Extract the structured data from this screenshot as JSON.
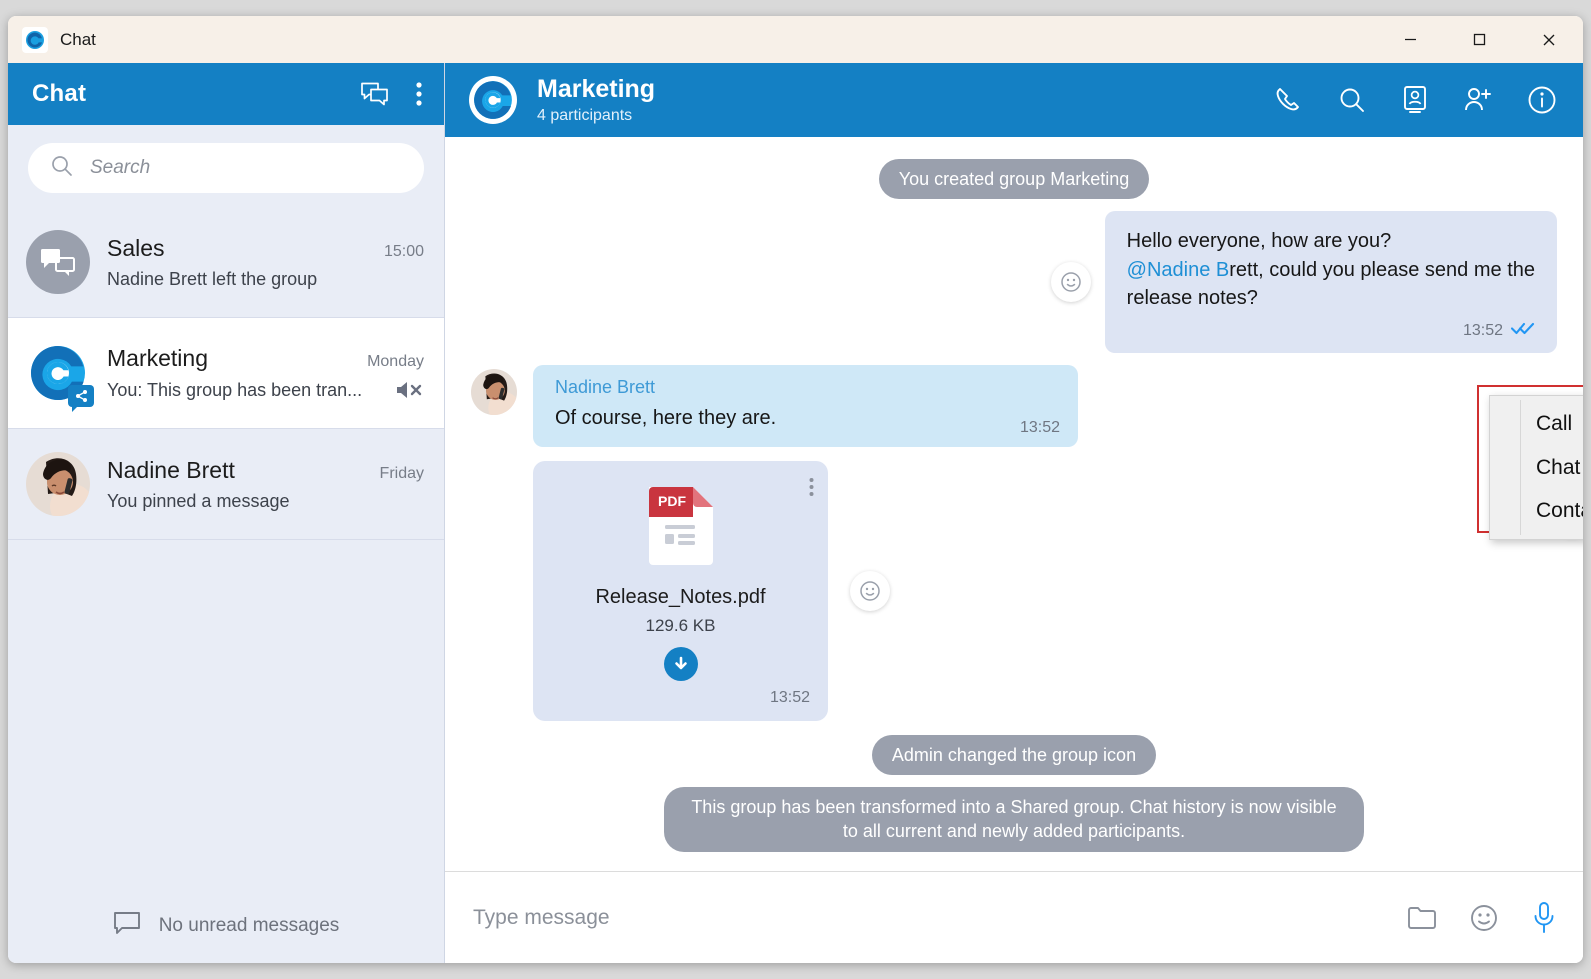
{
  "window": {
    "app_title": "Chat",
    "logo_letter": "G",
    "minimize_label": "Minimize",
    "maximize_label": "Maximize",
    "close_label": "Close"
  },
  "sidebar": {
    "header_title": "Chat",
    "new_chat_icon": "new-chat-icon",
    "menu_icon": "kebab-menu-icon",
    "search": {
      "placeholder": "Search",
      "value": "",
      "icon": "search-icon"
    },
    "items": [
      {
        "name": "Sales",
        "time": "15:00",
        "preview": "Nadine Brett left the group",
        "avatar_type": "group-generic",
        "active": false,
        "muted": false
      },
      {
        "name": "Marketing",
        "time": "Monday",
        "preview": "You: This group has been tran...",
        "avatar_type": "logo",
        "active": true,
        "muted": true,
        "badge": "share-badge"
      },
      {
        "name": "Nadine Brett",
        "time": "Friday",
        "preview": "You pinned a message",
        "avatar_type": "photo",
        "active": false,
        "muted": false
      }
    ],
    "footer": {
      "icon": "message-outline-icon",
      "text": "No unread messages"
    }
  },
  "chat_header": {
    "title": "Marketing",
    "subtitle": "4 participants",
    "avatar_letter": "G",
    "actions": [
      {
        "icon": "phone-icon",
        "label": "Call"
      },
      {
        "icon": "search-icon",
        "label": "Search in chat"
      },
      {
        "icon": "screen-share-icon",
        "label": "Screen share"
      },
      {
        "icon": "add-person-icon",
        "label": "Add participant"
      },
      {
        "icon": "info-icon",
        "label": "Chat information"
      }
    ]
  },
  "messages": [
    {
      "kind": "system",
      "text": "You created group Marketing"
    },
    {
      "kind": "outgoing",
      "line1": "Hello everyone, how are you?",
      "mention": "@Nadine B",
      "line2_rest": "rett, could you please send me the",
      "line3": "release notes?",
      "time": "13:52",
      "status": "read",
      "reaction_icon": "emoji-smiley-icon"
    },
    {
      "kind": "incoming",
      "sender": "Nadine Brett",
      "text": "Of course, here they are.",
      "time": "13:52"
    },
    {
      "kind": "file",
      "file_type": "PDF",
      "file_name": "Release_Notes.pdf",
      "file_size": "129.6 KB",
      "time": "13:52",
      "download_icon": "download-icon",
      "kebab_icon": "kebab-menu-icon",
      "reaction_icon": "emoji-smiley-icon"
    },
    {
      "kind": "system",
      "text": "Admin changed the group icon"
    },
    {
      "kind": "system",
      "text": "This group has been transformed into a Shared group. Chat history is now visible to all current and newly added participants."
    }
  ],
  "context_menu": {
    "items": [
      {
        "label": "Call"
      },
      {
        "label": "Chat with"
      },
      {
        "label": "Contact information"
      }
    ]
  },
  "composer": {
    "placeholder": "Type message",
    "value": "",
    "actions": [
      {
        "icon": "attach-folder-icon",
        "label": "Attach file"
      },
      {
        "icon": "emoji-smiley-icon",
        "label": "Emoji"
      },
      {
        "icon": "microphone-icon",
        "label": "Voice message"
      }
    ]
  },
  "colors": {
    "accent": "#1480c4",
    "titlebar": "#f7f0e8",
    "sidebar_bg": "#e9edf6",
    "bubble_out": "#dde4f3",
    "bubble_in": "#cfe8f7",
    "system_bubble": "#9aa0ad",
    "mention": "#1e8fd5",
    "highlight_border": "#d03030"
  }
}
